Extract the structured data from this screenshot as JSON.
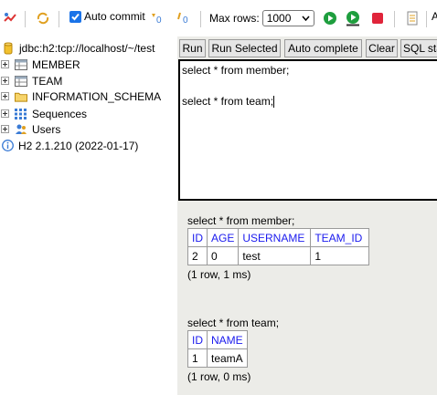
{
  "toolbar": {
    "auto_commit_label": "Auto commit",
    "auto_commit_checked": true,
    "max_rows_label": "Max rows:",
    "max_rows_value": "1000",
    "trailing_text": "A"
  },
  "tree": {
    "connection": "jdbc:h2:tcp://localhost/~/test",
    "items": [
      {
        "label": "MEMBER",
        "icon": "table-icon"
      },
      {
        "label": "TEAM",
        "icon": "table-icon"
      },
      {
        "label": "INFORMATION_SCHEMA",
        "icon": "folder-icon"
      },
      {
        "label": "Sequences",
        "icon": "sequence-icon"
      },
      {
        "label": "Users",
        "icon": "users-icon"
      }
    ],
    "version": "H2 2.1.210 (2022-01-17)"
  },
  "buttons": {
    "run": "Run",
    "run_selected": "Run Selected",
    "auto_complete": "Auto complete",
    "clear": "Clear",
    "sql_statement": "SQL sta"
  },
  "editor": {
    "line1": "select * from member;",
    "line2": "",
    "line3": "select * from team;"
  },
  "results": [
    {
      "query": "select * from member;",
      "columns": [
        "ID",
        "AGE",
        "USERNAME",
        "TEAM_ID"
      ],
      "rows": [
        [
          "2",
          "0",
          "test",
          "1"
        ]
      ],
      "summary": "(1 row, 1 ms)"
    },
    {
      "query": "select * from team;",
      "columns": [
        "ID",
        "NAME"
      ],
      "rows": [
        [
          "1",
          "teamA"
        ]
      ],
      "summary": "(1 row, 0 ms)"
    }
  ],
  "colors": {
    "header_text": "#1a1aee",
    "panel_bg": "#ecece8",
    "run_green": "#1e9e3e",
    "stop_red": "#e0243a"
  }
}
